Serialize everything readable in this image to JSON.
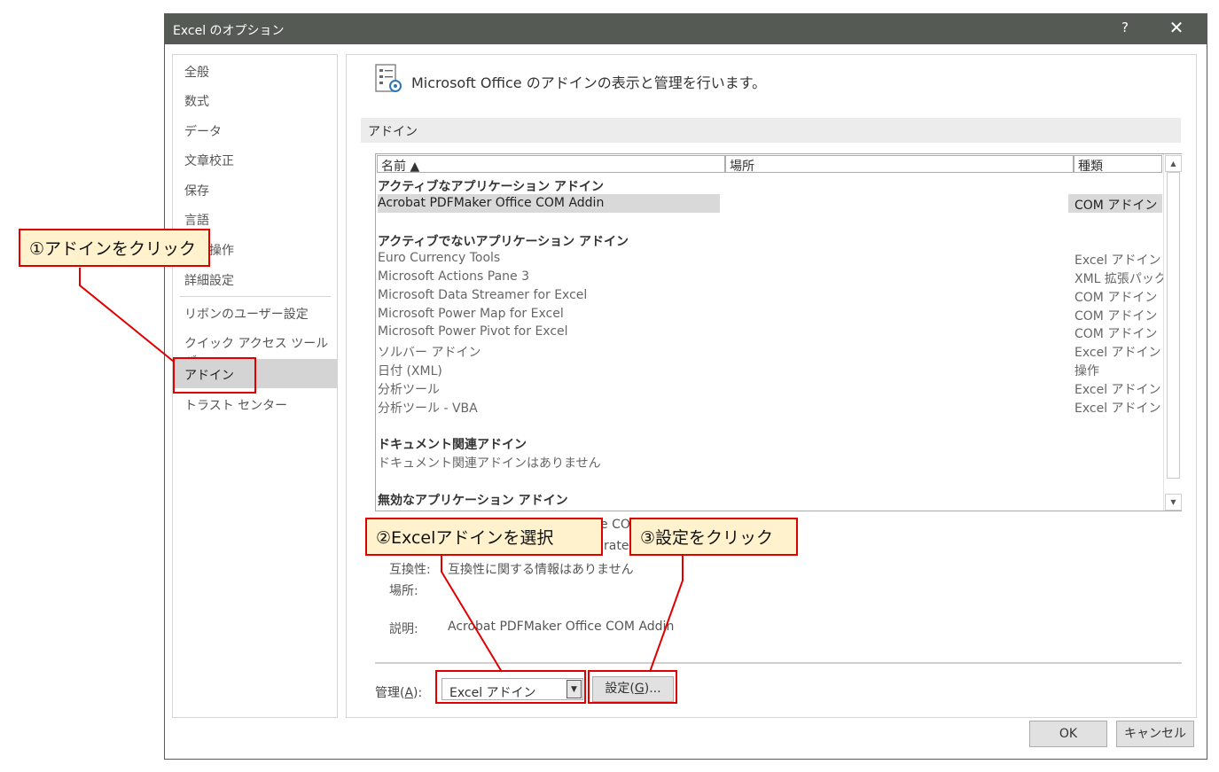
{
  "window": {
    "title": "Excel のオプション",
    "help": "?",
    "close": "✕"
  },
  "nav": {
    "items": [
      {
        "label": "全般"
      },
      {
        "label": "数式"
      },
      {
        "label": "データ"
      },
      {
        "label": "文章校正"
      },
      {
        "label": "保存"
      },
      {
        "label": "言語"
      },
      {
        "label": "簡単操作"
      },
      {
        "label": "詳細設定"
      },
      {
        "label": "リボンのユーザー設定"
      },
      {
        "label": "クイック アクセス ツール バー"
      },
      {
        "label": "アドイン",
        "selected": true
      },
      {
        "label": "トラスト センター"
      }
    ]
  },
  "header": {
    "text": "Microsoft Office のアドインの表示と管理を行います。",
    "icon": "addins-settings-icon"
  },
  "section": {
    "label": "アドイン"
  },
  "table": {
    "columns": [
      "名前 ▲",
      "場所",
      "種類"
    ],
    "rows": [
      {
        "name": "アクティブなアプリケーション アドイン",
        "type": "",
        "group": true
      },
      {
        "name": "Acrobat PDFMaker Office COM Addin",
        "type": "COM アドイン",
        "selected": true
      },
      {
        "name": "",
        "type": ""
      },
      {
        "name": "アクティブでないアプリケーション アドイン",
        "type": "",
        "group": true
      },
      {
        "name": "Euro Currency Tools",
        "type": "Excel アドイン"
      },
      {
        "name": "Microsoft Actions Pane 3",
        "type": "XML 拡張パック"
      },
      {
        "name": "Microsoft Data Streamer for Excel",
        "type": "COM アドイン"
      },
      {
        "name": "Microsoft Power Map for Excel",
        "type": "COM アドイン"
      },
      {
        "name": "Microsoft Power Pivot for Excel",
        "type": "COM アドイン"
      },
      {
        "name": "ソルバー アドイン",
        "type": "Excel アドイン"
      },
      {
        "name": "日付 (XML)",
        "type": "操作"
      },
      {
        "name": "分析ツール",
        "type": "Excel アドイン"
      },
      {
        "name": "分析ツール - VBA",
        "type": "Excel アドイン"
      },
      {
        "name": "",
        "type": ""
      },
      {
        "name": "ドキュメント関連アドイン",
        "type": "",
        "group": true
      },
      {
        "name": "  ドキュメント関連アドインはありません",
        "type": ""
      },
      {
        "name": "",
        "type": ""
      },
      {
        "name": "無効なアプリケーション アドイン",
        "type": "",
        "group": true
      }
    ]
  },
  "details": {
    "partial_publisher": "e CO",
    "partial_publisher2": "rate",
    "compat_label": "互換性:",
    "compat_value": "互換性に関する情報はありません",
    "location_label": "場所:",
    "desc_label": "説明:",
    "desc_value": "Acrobat PDFMaker Office COM Addin"
  },
  "manage": {
    "label": "管理(A):",
    "label_plain": "管理(",
    "label_key": "A",
    "label_end": "):",
    "selected": "Excel アドイン",
    "go_button": "設定(G)...",
    "go_plain": "設定(",
    "go_key": "G",
    "go_end": ")..."
  },
  "footer": {
    "ok": "OK",
    "cancel": "キャンセル"
  },
  "callouts": {
    "c1": "①アドインをクリック",
    "c2": "②Excelアドインを選択",
    "c3": "③設定をクリック",
    "color": "#e00000",
    "fill": "#fff2cc"
  }
}
